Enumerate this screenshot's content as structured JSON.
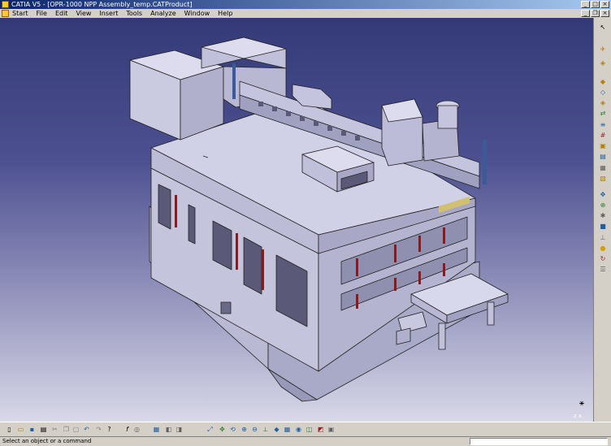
{
  "window": {
    "title": "CATIA V5 - [OPR-1000 NPP Assembly_temp.CATProduct]"
  },
  "menu": {
    "items": [
      "Start",
      "File",
      "Edit",
      "View",
      "Insert",
      "Tools",
      "Analyze",
      "Window",
      "Help"
    ]
  },
  "status": {
    "message": "Select an object or a command",
    "command_value": ""
  },
  "icons": {
    "right_toolbar": [
      "select-icon",
      "fly-mode-icon",
      "insert-new-component-icon",
      "insert-new-product-icon",
      "insert-new-part-icon",
      "existing-component-icon",
      "replace-component-icon",
      "graph-tree-reorder-icon",
      "generate-numbering-icon",
      "selective-load-icon",
      "manage-representations-icon",
      "multi-instantiation-icon",
      "fast-multi-instantiation-icon",
      "manipulation-icon",
      "snap-icon",
      "explode-icon",
      "stop-manipulate-icon",
      "constraint-icon",
      "bill-of-material-icon",
      "lightbulb-icon",
      "update-icon"
    ],
    "bottom_toolbar": [
      "new-icon",
      "open-icon",
      "save-icon",
      "print-icon",
      "cut-icon",
      "copy-icon",
      "paste-icon",
      "undo-icon",
      "redo-icon",
      "whats-this-icon",
      "formula-icon",
      "knowledge-icon",
      "catalog-icon",
      "measure-icon",
      "fly-icon",
      "fit-all-icon",
      "pan-icon",
      "rotate-icon",
      "zoom-in-icon",
      "zoom-out-icon",
      "normal-view-icon",
      "iso-view-icon",
      "multi-view-icon",
      "shading-icon",
      "hide-show-icon",
      "swap-visible-icon"
    ]
  },
  "colors": {
    "accent_title": "#0a246a",
    "viewport_top": "#343a78",
    "viewport_bottom": "#d8d8e8",
    "model_face": "#c9c9e0",
    "model_accent": "#8b1a1a"
  }
}
